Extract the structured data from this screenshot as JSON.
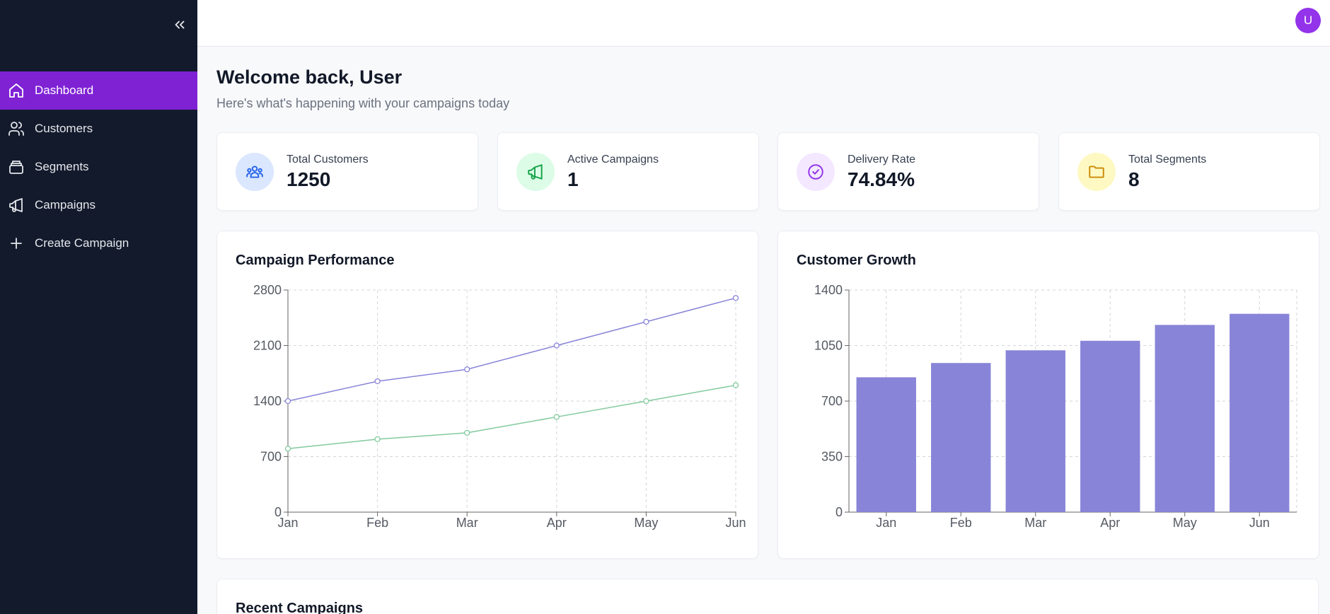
{
  "sidebar": {
    "items": [
      {
        "label": "Dashboard",
        "icon": "home-icon",
        "active": true
      },
      {
        "label": "Customers",
        "icon": "users-icon",
        "active": false
      },
      {
        "label": "Segments",
        "icon": "layers-icon",
        "active": false
      },
      {
        "label": "Campaigns",
        "icon": "megaphone-icon",
        "active": false
      },
      {
        "label": "Create Campaign",
        "icon": "plus-icon",
        "active": false
      }
    ]
  },
  "header": {
    "avatar_initial": "U"
  },
  "welcome": {
    "title": "Welcome back, User",
    "subtitle": "Here's what's happening with your campaigns today"
  },
  "stats": [
    {
      "label": "Total Customers",
      "value": "1250",
      "icon": "users-icon",
      "icon_bg": "#dbe7fe",
      "icon_color": "#2563eb"
    },
    {
      "label": "Active Campaigns",
      "value": "1",
      "icon": "megaphone-icon",
      "icon_bg": "#dcfce7",
      "icon_color": "#16a34a"
    },
    {
      "label": "Delivery Rate",
      "value": "74.84%",
      "icon": "check-circle-icon",
      "icon_bg": "#f3e8ff",
      "icon_color": "#9333ea"
    },
    {
      "label": "Total Segments",
      "value": "8",
      "icon": "folder-icon",
      "icon_bg": "#fef9c3",
      "icon_color": "#ca8a04"
    }
  ],
  "recent": {
    "title": "Recent Campaigns"
  },
  "colors": {
    "accent": "#7f22d4",
    "sidebar_bg": "#131a2c",
    "series_purple": "#8884d8",
    "series_green": "#82ca9d"
  },
  "chart_data": [
    {
      "type": "line",
      "title": "Campaign Performance",
      "categories": [
        "Jan",
        "Feb",
        "Mar",
        "Apr",
        "May",
        "Jun"
      ],
      "series": [
        {
          "values": [
            1400,
            1650,
            1800,
            2100,
            2400,
            2700
          ],
          "color": "#8884d8"
        },
        {
          "values": [
            800,
            920,
            1000,
            1200,
            1400,
            1600
          ],
          "color": "#82ca9d"
        }
      ],
      "yticks": [
        0,
        700,
        1400,
        2100,
        2800
      ],
      "ylim": [
        0,
        2800
      ],
      "grid": true
    },
    {
      "type": "bar",
      "title": "Customer Growth",
      "categories": [
        "Jan",
        "Feb",
        "Mar",
        "Apr",
        "May",
        "Jun"
      ],
      "values": [
        850,
        940,
        1020,
        1080,
        1180,
        1250
      ],
      "color": "#8884d8",
      "yticks": [
        0,
        350,
        700,
        1050,
        1400
      ],
      "ylim": [
        0,
        1400
      ],
      "grid": true
    }
  ]
}
